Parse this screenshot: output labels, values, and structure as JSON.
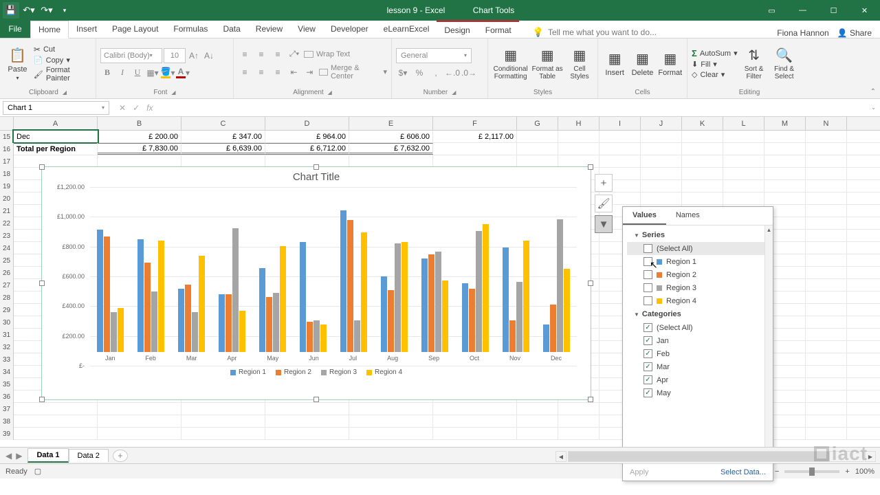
{
  "titlebar": {
    "title": "lesson 9 - Excel",
    "chart_tools": "Chart Tools"
  },
  "tabs": {
    "file": "File",
    "list": [
      "Home",
      "Insert",
      "Page Layout",
      "Formulas",
      "Data",
      "Review",
      "View",
      "Developer",
      "eLearnExcel",
      "Design",
      "Format"
    ],
    "active": "Home",
    "tellme": "Tell me what you want to do...",
    "user": "Fiona Hannon",
    "share": "Share"
  },
  "ribbon": {
    "clipboard": {
      "paste": "Paste",
      "cut": "Cut",
      "copy": "Copy",
      "fmt": "Format Painter",
      "label": "Clipboard"
    },
    "font": {
      "name": "Calibri (Body)",
      "size": "10",
      "b": "B",
      "i": "I",
      "u": "U",
      "label": "Font"
    },
    "align": {
      "wrap": "Wrap Text",
      "merge": "Merge & Center",
      "label": "Alignment"
    },
    "number": {
      "fmt": "General",
      "label": "Number"
    },
    "styles": {
      "cond": "Conditional Formatting",
      "fmt_tbl": "Format as Table",
      "cell": "Cell Styles",
      "label": "Styles"
    },
    "cells": {
      "insert": "Insert",
      "delete": "Delete",
      "format": "Format",
      "label": "Cells"
    },
    "editing": {
      "autosum": "AutoSum",
      "fill": "Fill",
      "clear": "Clear",
      "sort": "Sort & Filter",
      "find": "Find & Select",
      "label": "Editing"
    }
  },
  "namebox": "Chart 1",
  "columns": [
    "A",
    "B",
    "C",
    "D",
    "E",
    "F",
    "G",
    "H",
    "I",
    "J",
    "K",
    "L",
    "M",
    "N"
  ],
  "rows": {
    "r15": {
      "num": "15",
      "A": "Dec",
      "B": "£           200.00",
      "C": "£           347.00",
      "D": "£           964.00",
      "E": "£           606.00",
      "F": "£        2,117.00"
    },
    "r16": {
      "num": "16",
      "A": "Total per Region",
      "B": "£        7,830.00",
      "C": "£        6,639.00",
      "D": "£        6,712.00",
      "E": "£        7,632.00"
    },
    "empty": [
      "17",
      "18",
      "19",
      "20",
      "21",
      "22",
      "23",
      "24",
      "25",
      "26",
      "27",
      "28",
      "29",
      "30",
      "31",
      "32",
      "33",
      "34",
      "35",
      "36",
      "37",
      "38",
      "39"
    ]
  },
  "chart": {
    "title": "Chart Title",
    "y_ticks": [
      "£-",
      "£200.00",
      "£400.00",
      "£600.00",
      "£800.00",
      "£1,000.00",
      "£1,200.00"
    ],
    "legend": [
      "Region 1",
      "Region 2",
      "Region 3",
      "Region 4"
    ]
  },
  "chart_data": {
    "type": "bar",
    "title": "Chart Title",
    "categories": [
      "Jan",
      "Feb",
      "Mar",
      "Apr",
      "May",
      "Jun",
      "Jul",
      "Aug",
      "Sep",
      "Oct",
      "Nov",
      "Dec"
    ],
    "series": [
      {
        "name": "Region 1",
        "color": "#5B9BD5",
        "values": [
          890,
          820,
          460,
          420,
          610,
          800,
          1030,
          550,
          680,
          500,
          760,
          200
        ]
      },
      {
        "name": "Region 2",
        "color": "#ED7D31",
        "values": [
          840,
          650,
          490,
          420,
          400,
          220,
          960,
          450,
          710,
          460,
          230,
          347
        ]
      },
      {
        "name": "Region 3",
        "color": "#A5A5A5",
        "values": [
          290,
          440,
          290,
          900,
          430,
          230,
          230,
          790,
          730,
          880,
          510,
          964
        ]
      },
      {
        "name": "Region 4",
        "color": "#FFC000",
        "values": [
          320,
          810,
          700,
          300,
          770,
          200,
          870,
          800,
          520,
          930,
          810,
          606
        ]
      }
    ],
    "ylim": [
      0,
      1200
    ],
    "ylabel": "",
    "xlabel": ""
  },
  "filter": {
    "tabs": [
      "Values",
      "Names"
    ],
    "series_label": "Series",
    "select_all": "(Select All)",
    "series": [
      {
        "label": "Region 1",
        "color": "#5B9BD5"
      },
      {
        "label": "Region 2",
        "color": "#ED7D31"
      },
      {
        "label": "Region 3",
        "color": "#A5A5A5"
      },
      {
        "label": "Region 4",
        "color": "#FFC000"
      }
    ],
    "cat_label": "Categories",
    "categories": [
      "Jan",
      "Feb",
      "Mar",
      "Apr",
      "May"
    ],
    "apply": "Apply",
    "select_data": "Select Data..."
  },
  "sheets": {
    "tabs": [
      "Data 1",
      "Data 2"
    ],
    "active": "Data 1"
  },
  "status": {
    "ready": "Ready",
    "zoom": "100%"
  },
  "watermark": "iact"
}
